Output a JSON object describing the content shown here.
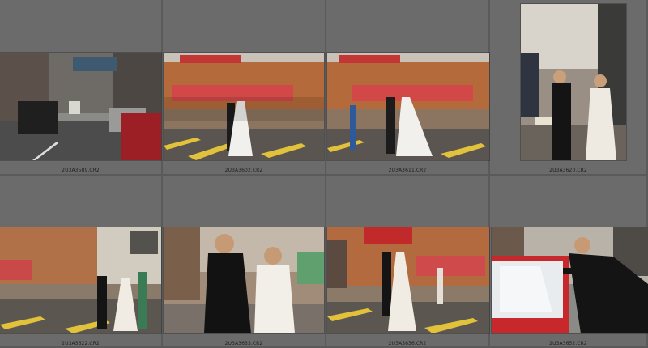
{
  "filmstrip": {
    "items": [
      {
        "filename": "2U3A3589.CR2",
        "scene": "street-traffic-icon"
      },
      {
        "filename": "2U3A3602.CR2",
        "scene": "crosswalk-couple-icon"
      },
      {
        "filename": "2U3A3611.CR2",
        "scene": "crosswalk-couple-icon"
      },
      {
        "filename": "2U3A3620.CR2",
        "scene": "portrait-couple-icon"
      },
      {
        "filename": "2U3A3622.CR2",
        "scene": "street-couple-icon"
      },
      {
        "filename": "2U3A3633.CR2",
        "scene": "closeup-couple-icon"
      },
      {
        "filename": "2U3A3636.CR2",
        "scene": "crosswalk-couple-icon"
      },
      {
        "filename": "2U3A3652.CR2",
        "scene": "taxi-man-icon"
      }
    ]
  }
}
